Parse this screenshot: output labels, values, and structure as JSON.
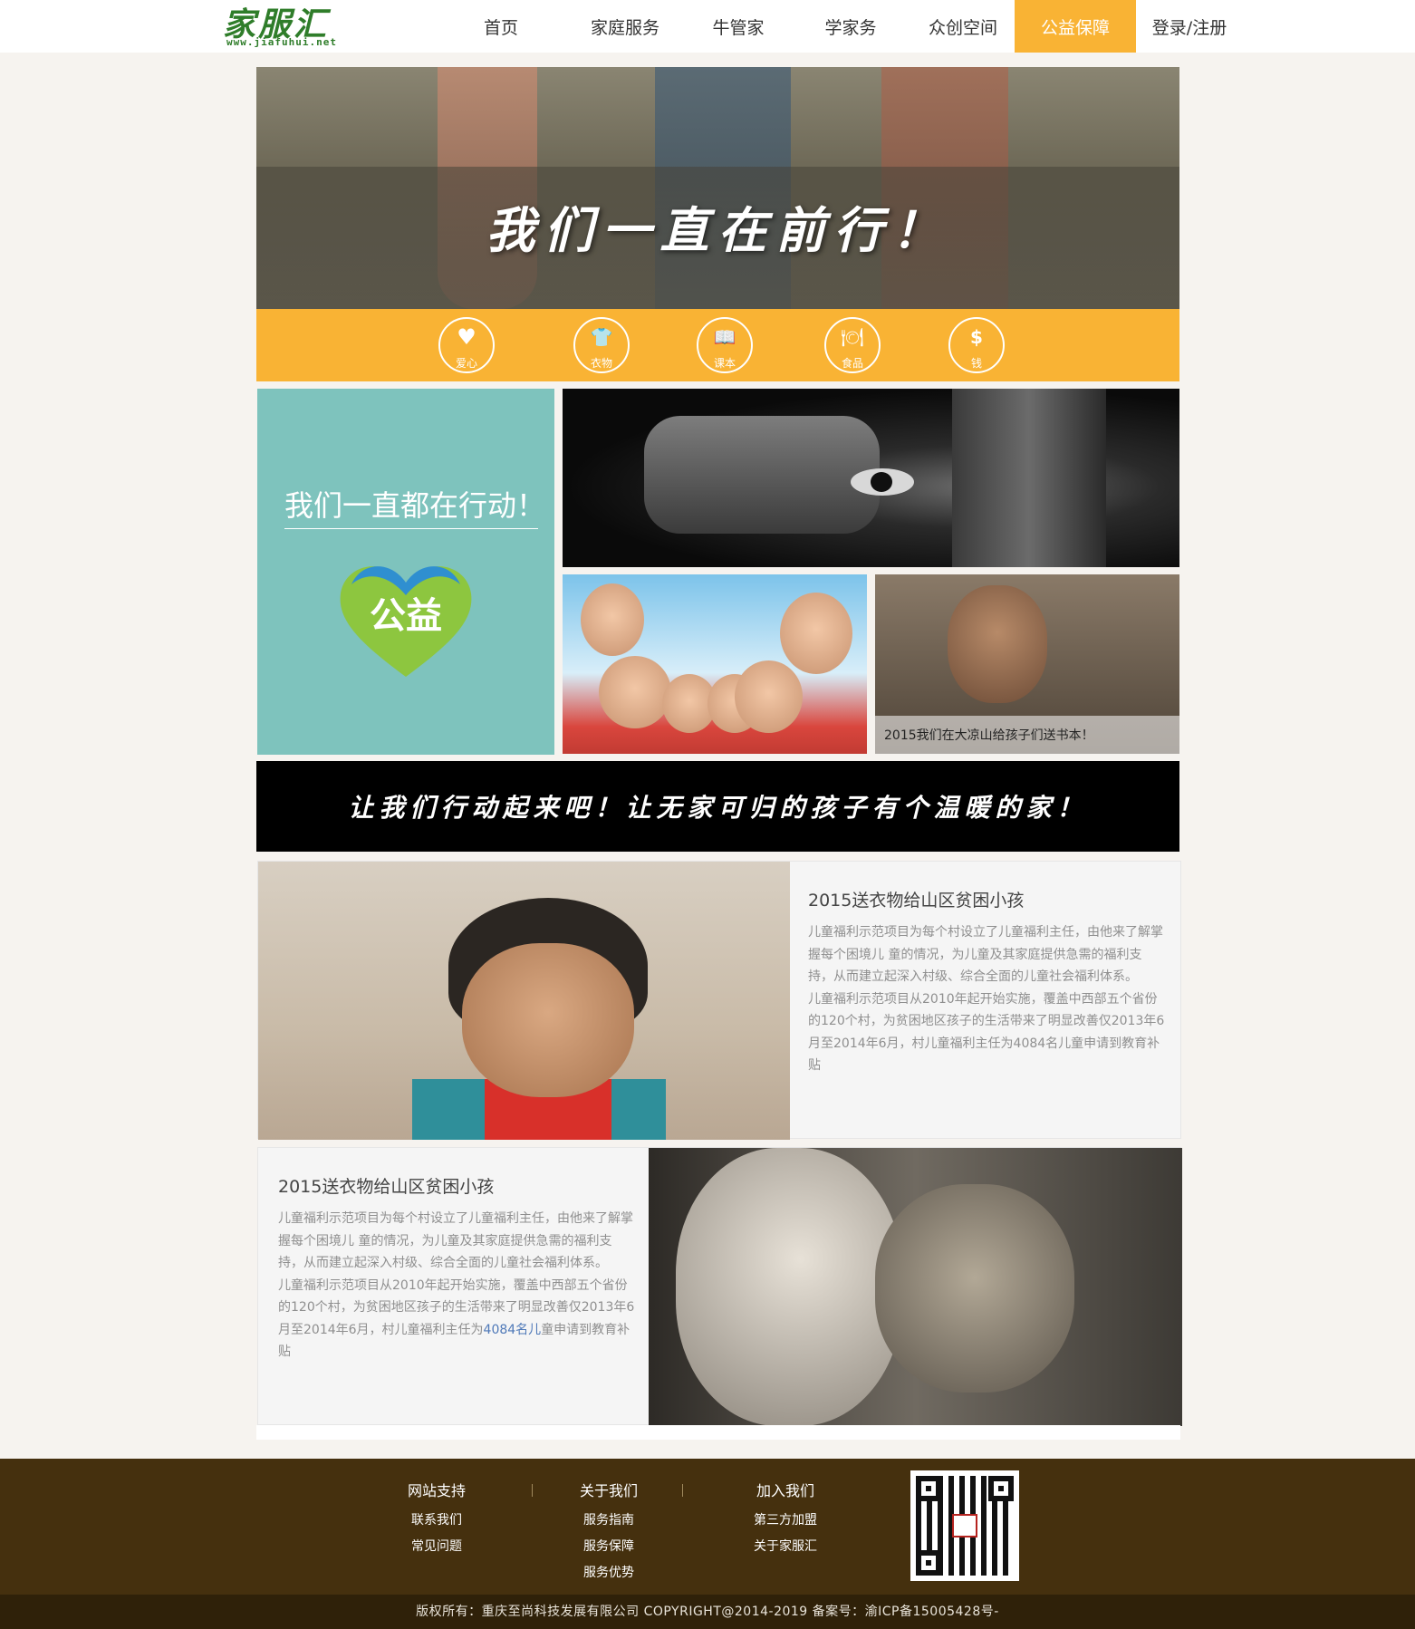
{
  "header": {
    "logo_cn": "家服汇",
    "logo_url": "www.jiafuhui.net",
    "nav": [
      {
        "label": "首页"
      },
      {
        "label": "家庭服务"
      },
      {
        "label": "牛管家"
      },
      {
        "label": "学家务"
      },
      {
        "label": "众创空间"
      },
      {
        "label": "公益保障",
        "active": true
      },
      {
        "label": "登录/注册"
      }
    ]
  },
  "hero": {
    "title": "我们一直在前行！"
  },
  "categories": [
    {
      "label": "爱心",
      "icon": "heart-icon",
      "glyph": "♥"
    },
    {
      "label": "衣物",
      "icon": "tshirt-icon",
      "glyph": "👕"
    },
    {
      "label": "课本",
      "icon": "book-icon",
      "glyph": "📖"
    },
    {
      "label": "食品",
      "icon": "food-cloche-icon",
      "glyph": "🍽"
    },
    {
      "label": "钱",
      "icon": "money-bag-icon",
      "glyph": "$"
    }
  ],
  "grid": {
    "teal_title": "我们一直都在行动！",
    "heart_text": "公益",
    "boy_caption": "2015我们在大凉山给孩子们送书本！"
  },
  "slogan": "让我们行动起来吧！让无家可归的孩子有个温暖的家！",
  "stories": [
    {
      "title": "2015送衣物给山区贫困小孩",
      "p1": "儿童福利示范项目为每个村设立了儿童福利主任，由他来了解掌握每个困境儿 童的情况，为儿童及其家庭提供急需的福利支持，从而建立起深入村级、综合全面的儿童社会福利体系。",
      "p2": "儿童福利示范项目从2010年起开始实施，覆盖中西部五个省份的120个村，为贫困地区孩子的生活带来了明显改善仅2013年6月至2014年6月，村儿童福利主任为4084名儿童申请到教育补贴"
    },
    {
      "title": "2015送衣物给山区贫困小孩",
      "p1": "儿童福利示范项目为每个村设立了儿童福利主任，由他来了解掌握每个困境儿 童的情况，为儿童及其家庭提供急需的福利支持，从而建立起深入村级、综合全面的儿童社会福利体系。",
      "p2a": "儿童福利示范项目从2010年起开始实施，覆盖中西部五个省份的120个村，为贫困地区孩子的生活带来了明显改善仅2013年6月至2014年6月，村儿童福利主任为",
      "p2b": "4084名儿",
      "p2c": "童申请到教育补贴"
    }
  ],
  "footer": {
    "columns": [
      {
        "head": "网站支持",
        "links": [
          "联系我们",
          "常见问题"
        ]
      },
      {
        "head": "关于我们",
        "links": [
          "服务指南",
          "服务保障",
          "服务优势"
        ]
      },
      {
        "head": "加入我们",
        "links": [
          "第三方加盟",
          "关于家服汇"
        ]
      }
    ],
    "copyright": "版权所有：重庆至尚科技发展有限公司 COPYRIGHT@2014-2019 备案号：渝ICP备15005428号-"
  },
  "colors": {
    "accent": "#f9b334",
    "teal": "#7ec3bd",
    "footer_bg": "#45300e",
    "copyright_bg": "#2f2109",
    "logo_green": "#2f7d2a"
  }
}
